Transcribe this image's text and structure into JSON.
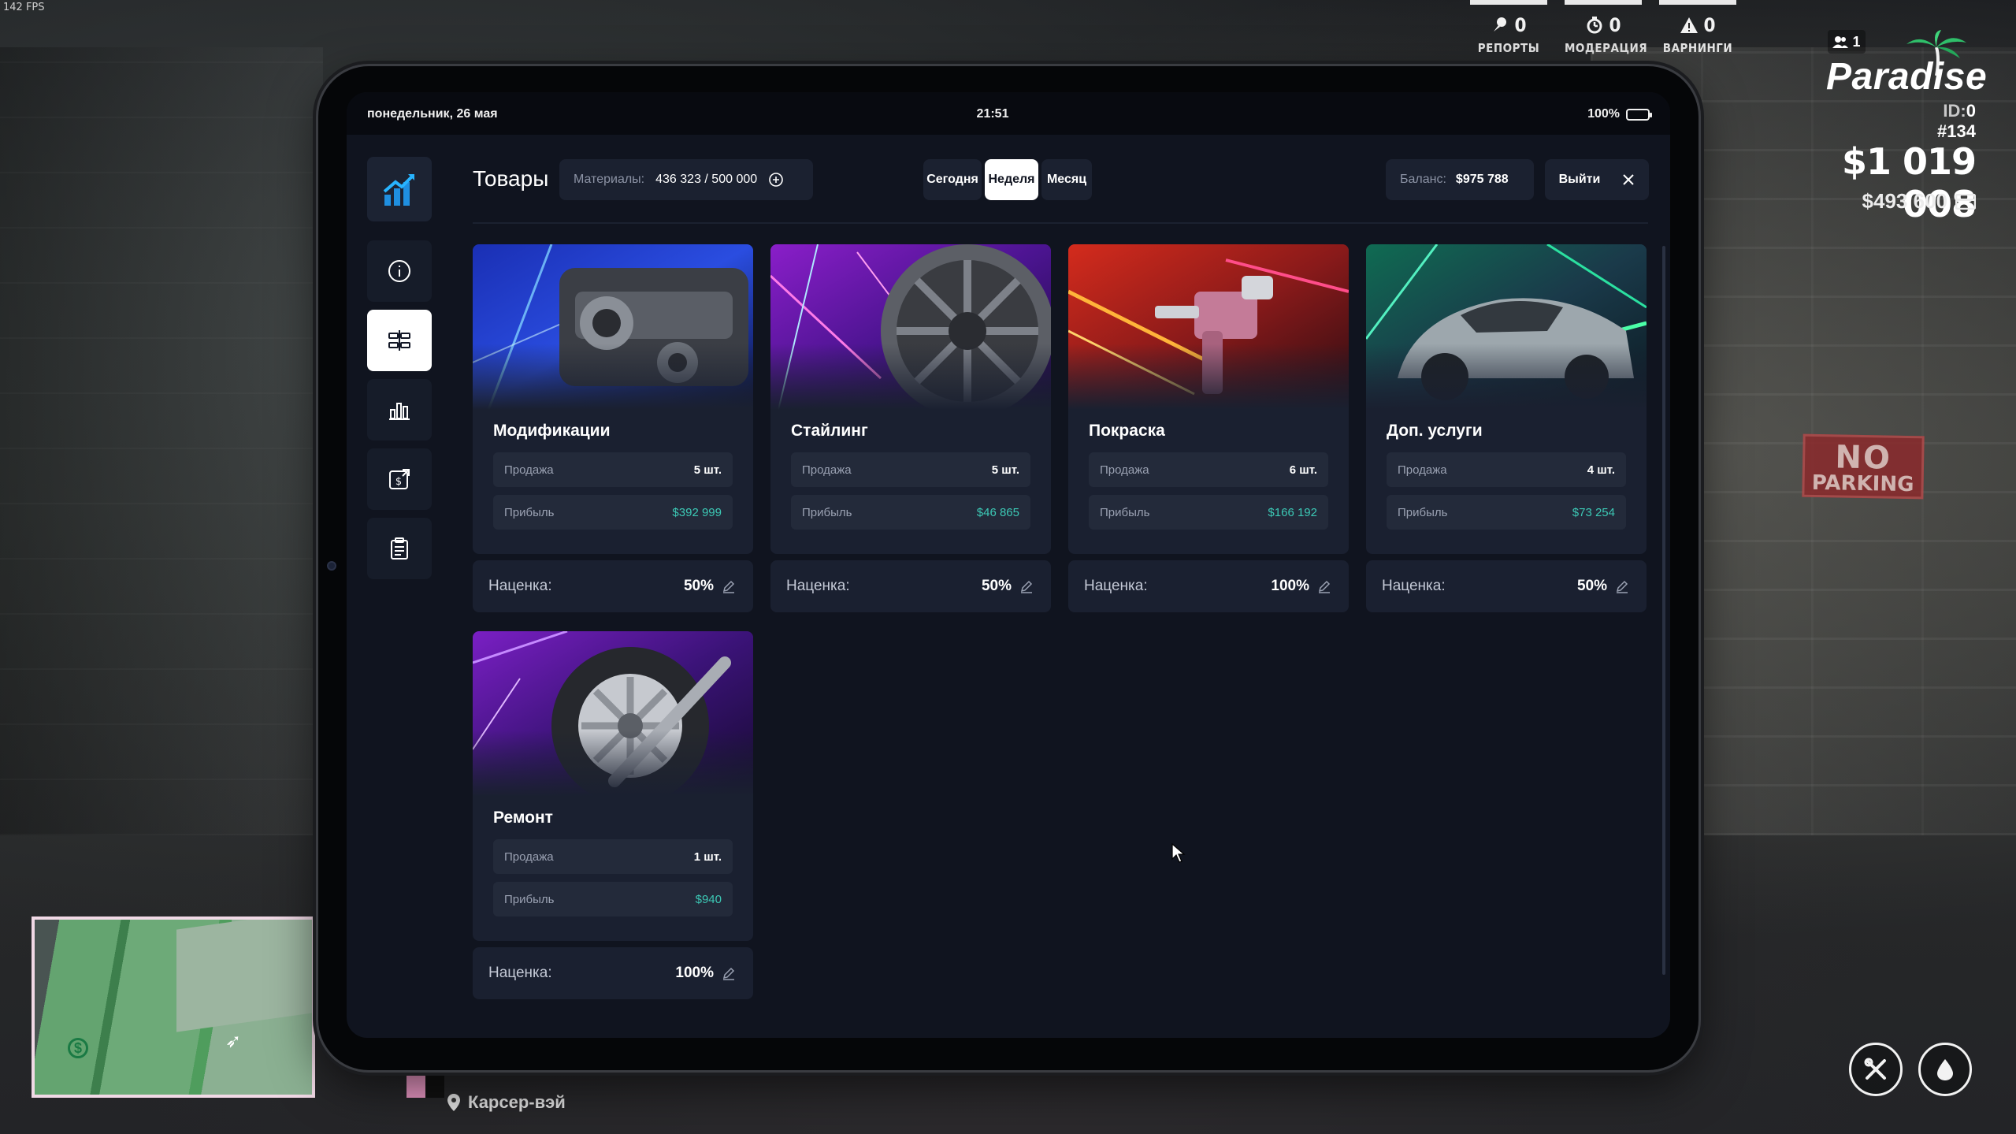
{
  "fps": "142 FPS",
  "admin_stats": [
    {
      "value": "0",
      "label": "РЕПОРТЫ",
      "icon": "report-icon"
    },
    {
      "value": "0",
      "label": "МОДЕРАЦИЯ",
      "icon": "moderation-icon"
    },
    {
      "value": "0",
      "label": "ВАРНИНГИ",
      "icon": "warning-icon"
    }
  ],
  "brand": {
    "players_online": "1",
    "logo": "Paradise",
    "id_label": "ID:",
    "id_value": "0 #134"
  },
  "money": {
    "cash": "$1 019 008",
    "bank": "$493 600"
  },
  "location": "Карсер-вэй",
  "background_sign": {
    "line1": "NO",
    "line2": "PARKING"
  },
  "tablet": {
    "status": {
      "date": "понедельник, 26 мая",
      "time": "21:51",
      "battery": "100%"
    },
    "sidebar": [
      {
        "name": "info",
        "icon": "info-icon",
        "active": false
      },
      {
        "name": "goods",
        "icon": "goods-icon",
        "active": true
      },
      {
        "name": "stats",
        "icon": "stats-icon",
        "active": false
      },
      {
        "name": "finance",
        "icon": "finance-icon",
        "active": false
      },
      {
        "name": "orders",
        "icon": "clipboard-icon",
        "active": false
      }
    ],
    "header": {
      "title": "Товары",
      "materials_label": "Материалы:",
      "materials_value": "436 323 / 500 000",
      "tabs": [
        "Сегодня",
        "Неделя",
        "Месяц"
      ],
      "active_tab": "Неделя",
      "balance_label": "Баланс:",
      "balance_value": "$975 788",
      "exit_label": "Выйти"
    },
    "cards": [
      {
        "name": "Модификации",
        "sales_label": "Продажа",
        "sales": "5 шт.",
        "profit_label": "Прибыль",
        "profit": "$392 999",
        "markup_label": "Наценка:",
        "markup": "50%"
      },
      {
        "name": "Стайлинг",
        "sales_label": "Продажа",
        "sales": "5 шт.",
        "profit_label": "Прибыль",
        "profit": "$46 865",
        "markup_label": "Наценка:",
        "markup": "50%"
      },
      {
        "name": "Покраска",
        "sales_label": "Продажа",
        "sales": "6 шт.",
        "profit_label": "Прибыль",
        "profit": "$166 192",
        "markup_label": "Наценка:",
        "markup": "100%"
      },
      {
        "name": "Доп. услуги",
        "sales_label": "Продажа",
        "sales": "4 шт.",
        "profit_label": "Прибыль",
        "profit": "$73 254",
        "markup_label": "Наценка:",
        "markup": "50%"
      },
      {
        "name": "Ремонт",
        "sales_label": "Продажа",
        "sales": "1 шт.",
        "profit_label": "Прибыль",
        "profit": "$940",
        "markup_label": "Наценка:",
        "markup": "100%"
      }
    ]
  },
  "colors": {
    "accent_green": "#3cc8b5",
    "panel": "#1a2030",
    "screen_bg": "#10141f"
  }
}
